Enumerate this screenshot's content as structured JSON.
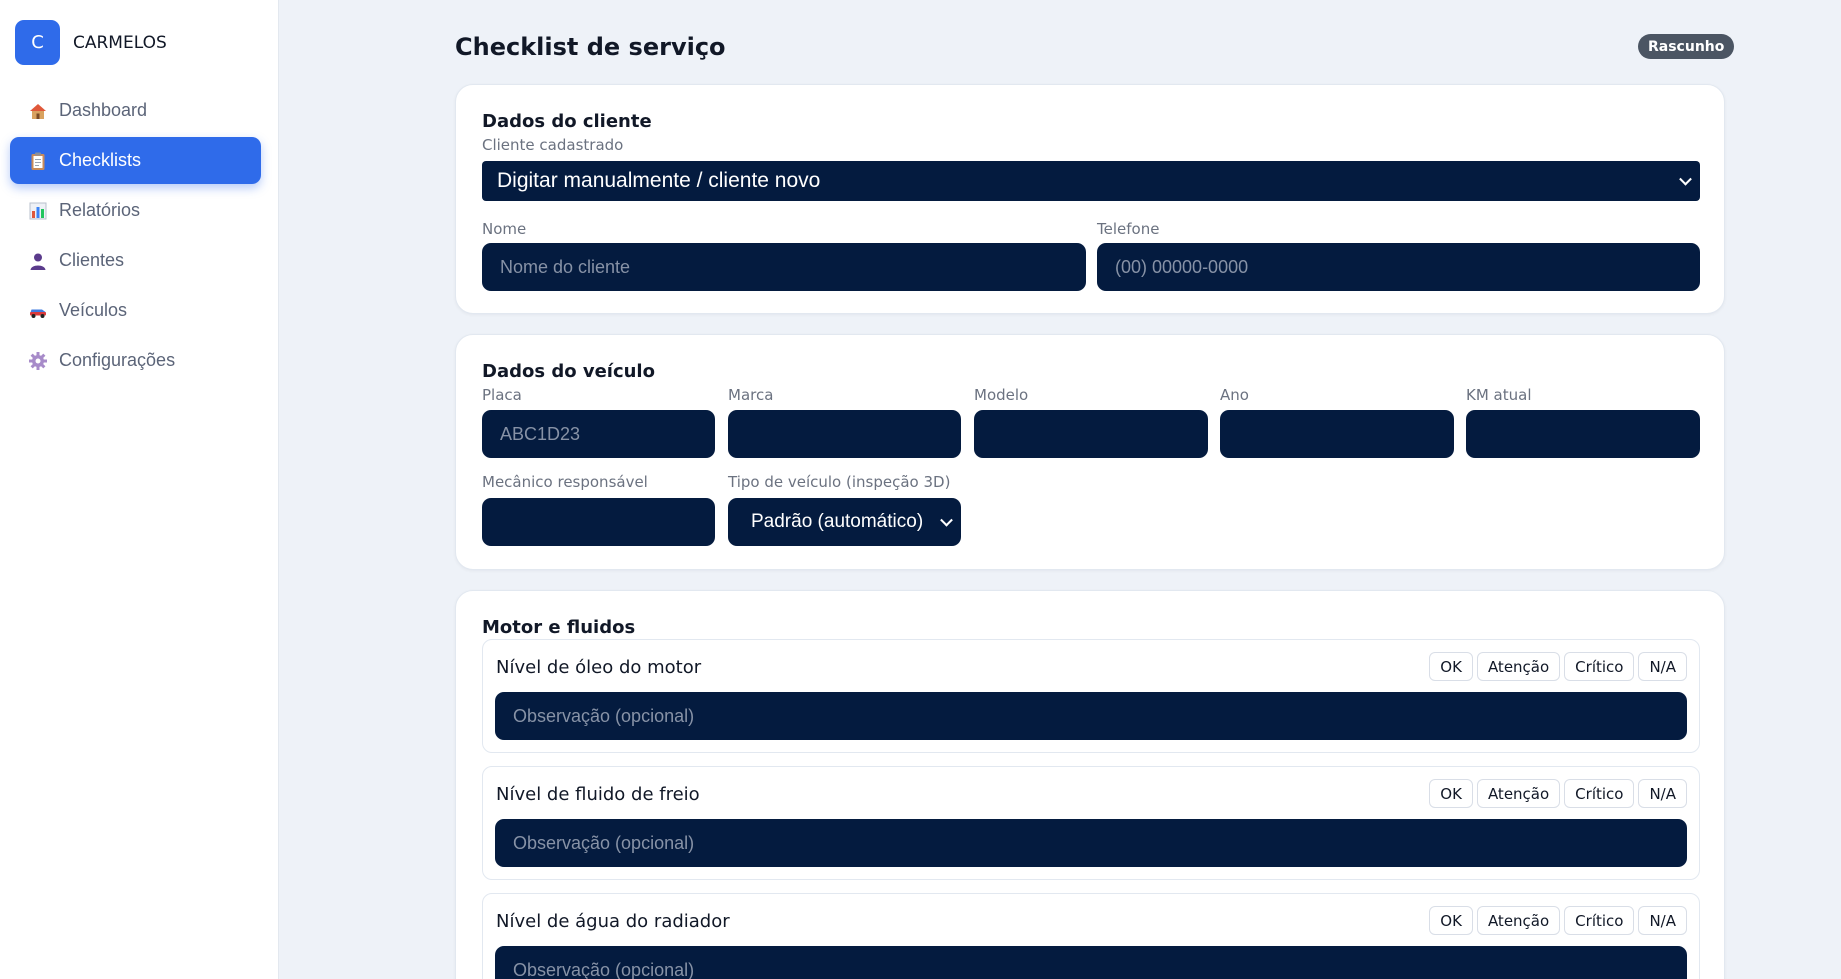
{
  "brand": {
    "logo_letter": "C",
    "name": "CARMELOS"
  },
  "sidebar": {
    "items": [
      {
        "label": "Dashboard",
        "icon": "house-icon"
      },
      {
        "label": "Checklists",
        "icon": "clipboard-icon",
        "active": true
      },
      {
        "label": "Relatórios",
        "icon": "bar-chart-icon"
      },
      {
        "label": "Clientes",
        "icon": "person-icon"
      },
      {
        "label": "Veículos",
        "icon": "car-icon"
      },
      {
        "label": "Configurações",
        "icon": "gear-icon"
      }
    ]
  },
  "header": {
    "title": "Checklist de serviço",
    "status": "Rascunho"
  },
  "client_card": {
    "title": "Dados do cliente",
    "registered_label": "Cliente cadastrado",
    "registered_value": "Digitar manualmente / cliente novo",
    "name_label": "Nome",
    "name_placeholder": "Nome do cliente",
    "phone_label": "Telefone",
    "phone_placeholder": "(00) 00000-0000"
  },
  "vehicle_card": {
    "title": "Dados do veículo",
    "plate_label": "Placa",
    "plate_placeholder": "ABC1D23",
    "brand_label": "Marca",
    "model_label": "Modelo",
    "year_label": "Ano",
    "km_label": "KM atual",
    "mechanic_label": "Mecânico responsável",
    "type_label": "Tipo de veículo (inspeção 3D)",
    "type_value": "Padrão (automático)"
  },
  "engine_card": {
    "title": "Motor e fluidos",
    "options": [
      "OK",
      "Atenção",
      "Crítico",
      "N/A"
    ],
    "obs_placeholder": "Observação (opcional)",
    "items": [
      {
        "label": "Nível de óleo do motor"
      },
      {
        "label": "Nível de fluido de freio"
      },
      {
        "label": "Nível de água do radiador"
      }
    ]
  },
  "colors": {
    "accent": "#2f6bea",
    "field_bg": "#041b3f",
    "badge_bg": "#4b5563",
    "page_bg": "#eef2f8"
  }
}
